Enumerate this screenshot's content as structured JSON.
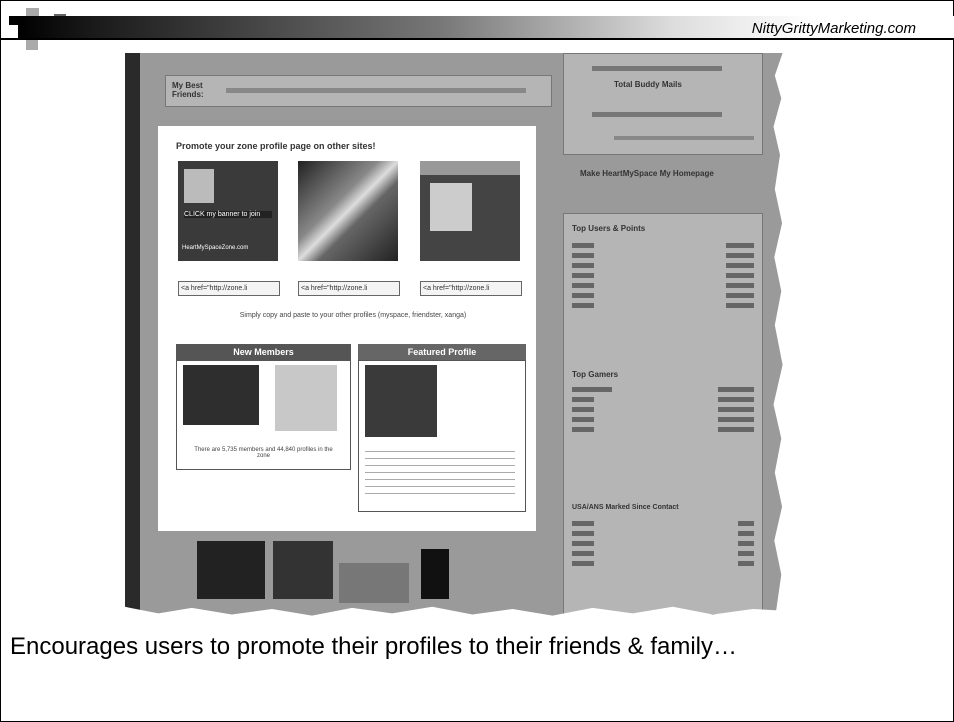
{
  "header": {
    "site": "NittyGrittyMarketing.com"
  },
  "screenshot": {
    "best_friends_label": "My Best Friends:",
    "promote_title": "Promote your zone profile page on other sites!",
    "badge1_text": "CLICK my banner to join",
    "badge1_footer": "HeartMySpaceZone.com",
    "code_box": "<a href=\"http://zone.li",
    "promote_note": "Simply copy and paste to your other profiles (myspace, friendster, xanga)",
    "new_members_title": "New Members",
    "featured_profile_title": "Featured Profile",
    "member_count_text": "There are 5,735 members and 44,840 profiles in the zone",
    "top_users_title": "Top Users & Points",
    "top_gamers_title": "Top Gamers",
    "most_contact_title": "USA/ANS Marked Since Contact",
    "make_homepage": "Make HeartMySpace My Homepage",
    "total_buddy": "Total Buddy Mails"
  },
  "caption": "Encourages users to promote their profiles to their friends & family…"
}
